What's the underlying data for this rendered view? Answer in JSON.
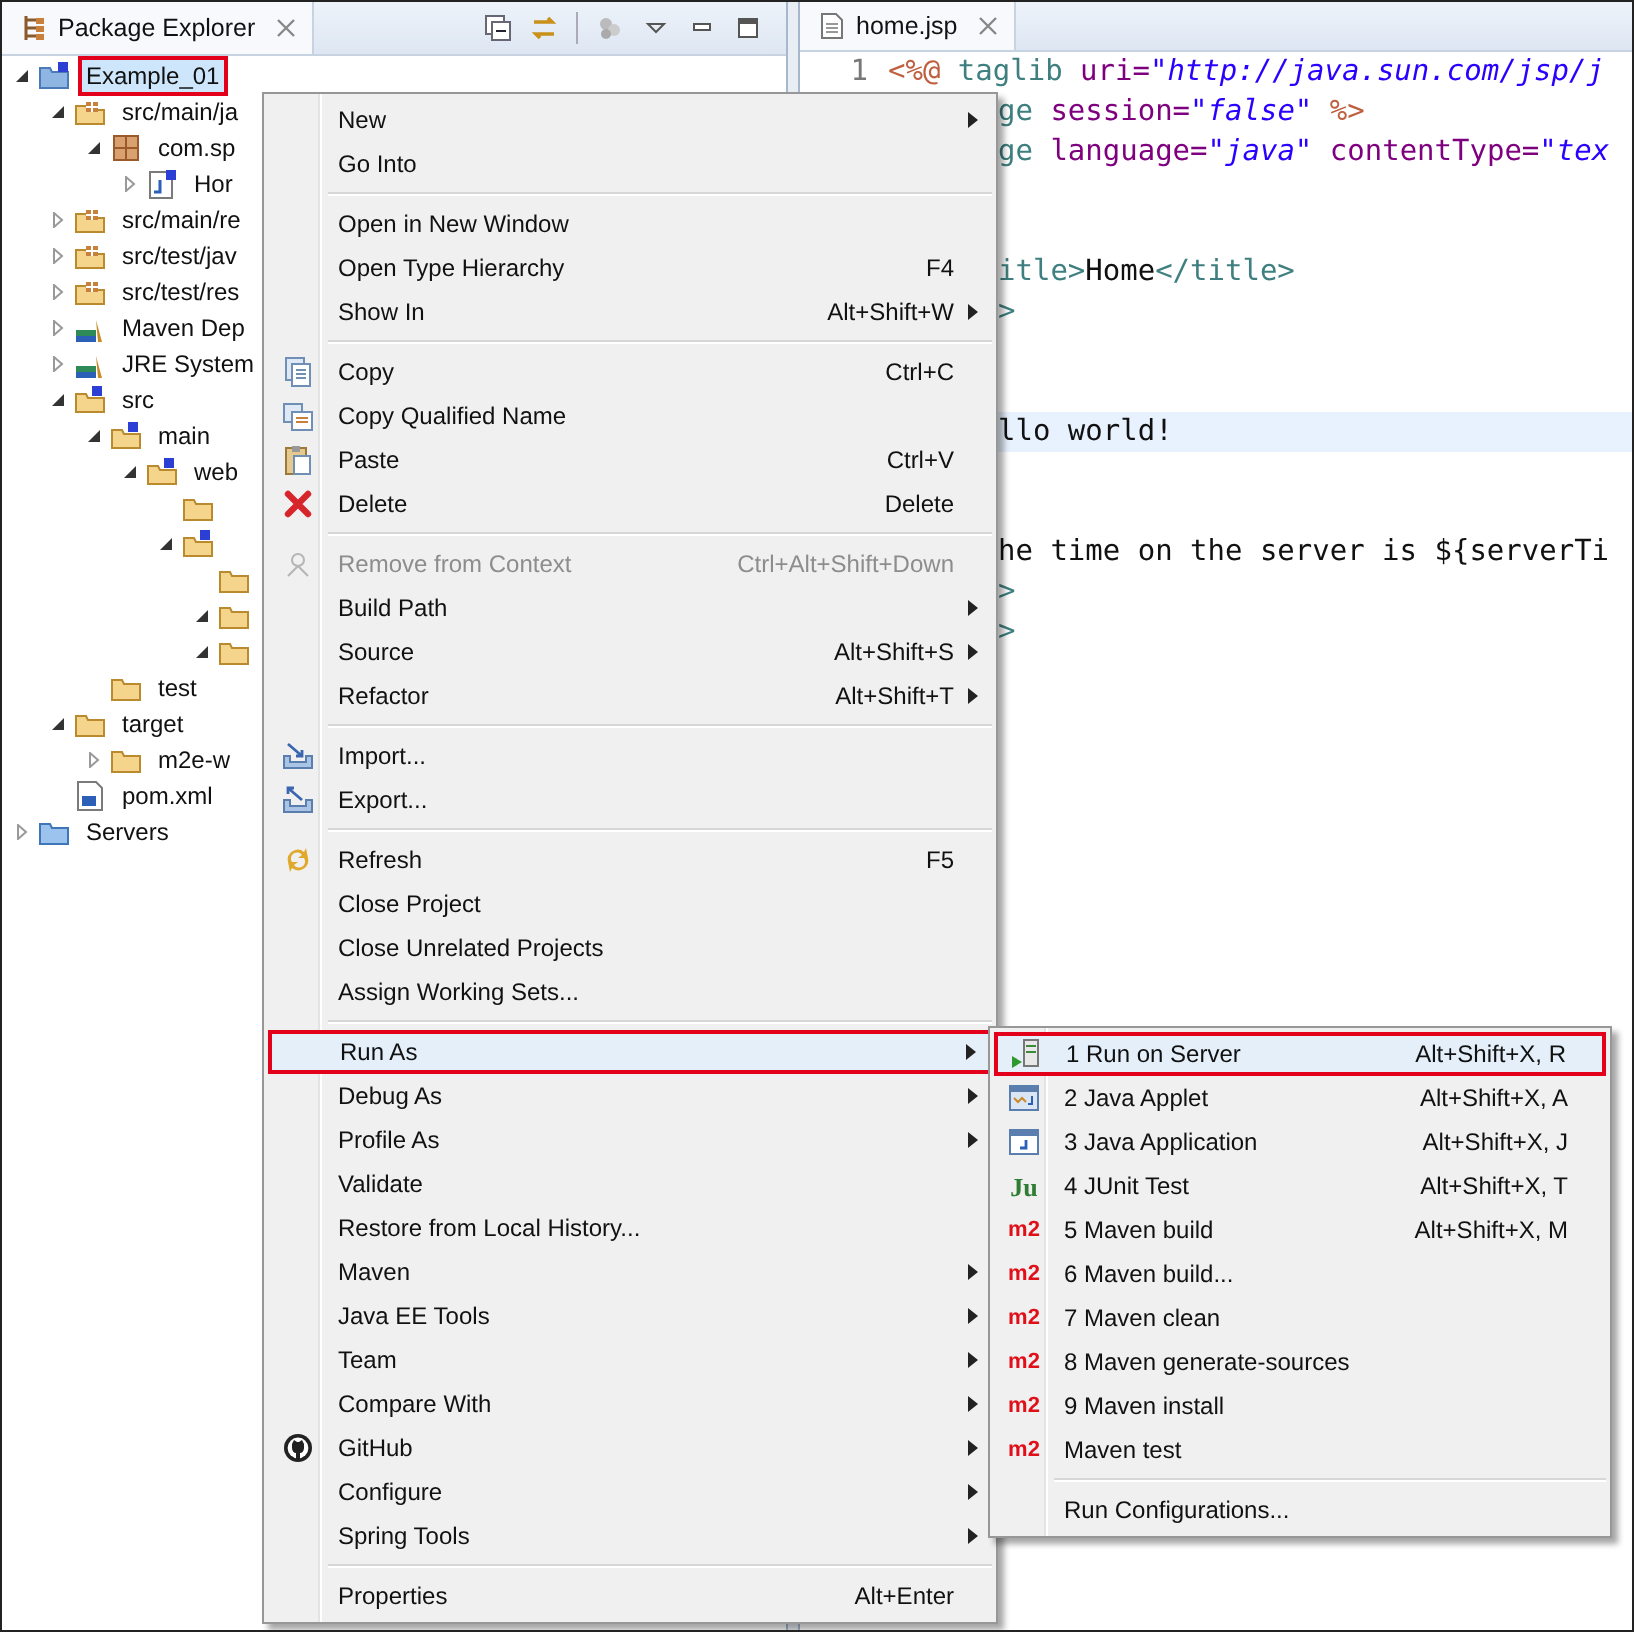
{
  "explorer": {
    "title": "Package Explorer",
    "tree": [
      {
        "kind": "project",
        "label": "Example_01",
        "expanded": true,
        "selected": true,
        "annotated": true,
        "children": [
          {
            "kind": "source-folder",
            "label": "src/main/ja",
            "expanded": true,
            "selected": false,
            "children": [
              {
                "kind": "package",
                "label": "com.sp",
                "expanded": true,
                "selected": false,
                "children": [
                  {
                    "kind": "java-file",
                    "label": "Hor",
                    "expanded": false,
                    "selected": false
                  }
                ]
              }
            ]
          },
          {
            "kind": "source-folder",
            "label": "src/main/re",
            "expanded": false,
            "selected": false
          },
          {
            "kind": "source-folder",
            "label": "src/test/jav",
            "expanded": false,
            "selected": false
          },
          {
            "kind": "source-folder",
            "label": "src/test/res",
            "expanded": false,
            "selected": false
          },
          {
            "kind": "library",
            "label": "Maven Dep",
            "expanded": false,
            "selected": false
          },
          {
            "kind": "library",
            "label": "JRE System",
            "expanded": false,
            "selected": false
          },
          {
            "kind": "web-folder",
            "label": "src",
            "expanded": true,
            "selected": false,
            "children": [
              {
                "kind": "web-folder",
                "label": "main",
                "expanded": true,
                "selected": false,
                "children": [
                  {
                    "kind": "web-folder",
                    "label": "web",
                    "expanded": true,
                    "selected": false,
                    "children": [
                      {
                        "kind": "folder"
                      },
                      {
                        "kind": "web-folder",
                        "expanded": true,
                        "children": [
                          {
                            "kind": "folder"
                          },
                          {
                            "kind": "folder",
                            "expanded": true
                          },
                          {
                            "kind": "folder",
                            "expanded": true
                          }
                        ]
                      }
                    ]
                  }
                ]
              },
              {
                "kind": "folder",
                "label": "test",
                "selected": false
              }
            ]
          },
          {
            "kind": "folder",
            "label": "target",
            "expanded": true,
            "selected": false,
            "children": [
              {
                "kind": "folder",
                "label": "m2e-w",
                "expanded": false,
                "selected": false
              }
            ]
          },
          {
            "kind": "pom",
            "label": "pom.xml",
            "selected": false
          }
        ]
      },
      {
        "kind": "servers",
        "label": "Servers",
        "expanded": false,
        "selected": false
      }
    ]
  },
  "editor": {
    "tab": "home.jsp",
    "lines": [
      {
        "number": "1",
        "current": false,
        "segments": [
          {
            "kind": "directive",
            "text": "<%@"
          },
          {
            "kind": "tag",
            "text": " taglib"
          },
          {
            "kind": "attr",
            "text": " uri="
          },
          {
            "kind": "string",
            "text": "\"http://java.sun.com/jsp/j"
          }
        ]
      },
      {
        "current": false,
        "segments": [
          {
            "kind": "tag",
            "text": "ge"
          },
          {
            "kind": "attr",
            "text": " session="
          },
          {
            "kind": "string",
            "text": "\"false\""
          },
          {
            "kind": "directive",
            "text": " %>"
          }
        ]
      },
      {
        "current": false,
        "segments": [
          {
            "kind": "tag",
            "text": "ge"
          },
          {
            "kind": "attr",
            "text": " language="
          },
          {
            "kind": "string",
            "text": "\"java\""
          },
          {
            "kind": "attr",
            "text": " contentType="
          },
          {
            "kind": "string",
            "text": "\"tex"
          }
        ]
      },
      {
        "current": false
      },
      {
        "current": false
      },
      {
        "current": false,
        "segments": [
          {
            "kind": "tag",
            "text": "itle>"
          },
          {
            "kind": "text",
            "text": "Home"
          },
          {
            "kind": "tag",
            "text": "</title>"
          }
        ]
      },
      {
        "current": false,
        "segments": [
          {
            "kind": "tag",
            "text": ">"
          }
        ]
      },
      {
        "current": false
      },
      {
        "current": false
      },
      {
        "current": true,
        "segments": [
          {
            "kind": "text",
            "text": "llo world!"
          }
        ]
      },
      {
        "current": false
      },
      {
        "current": false
      },
      {
        "current": false,
        "segments": [
          {
            "kind": "text",
            "text": "he time on the server is ${serverTi"
          }
        ]
      },
      {
        "current": false,
        "segments": [
          {
            "kind": "tag",
            "text": ">"
          }
        ]
      },
      {
        "current": false,
        "segments": [
          {
            "kind": "tag",
            "text": ">"
          }
        ]
      }
    ]
  },
  "menu": {
    "items": [
      {
        "kind": "item",
        "label": "New",
        "submenu": true,
        "disabled": false,
        "selected": false
      },
      {
        "kind": "item",
        "label": "Go Into",
        "submenu": false,
        "disabled": false,
        "selected": false
      },
      {
        "kind": "separator"
      },
      {
        "kind": "item",
        "label": "Open in New Window",
        "submenu": false,
        "disabled": false,
        "selected": false
      },
      {
        "kind": "item",
        "label": "Open Type Hierarchy",
        "shortcut": "F4",
        "submenu": false,
        "disabled": false,
        "selected": false
      },
      {
        "kind": "item",
        "label": "Show In",
        "shortcut": "Alt+Shift+W",
        "submenu": true,
        "disabled": false,
        "selected": false
      },
      {
        "kind": "separator"
      },
      {
        "kind": "item",
        "label": "Copy",
        "shortcut": "Ctrl+C",
        "submenu": false,
        "disabled": false,
        "selected": false
      },
      {
        "kind": "item",
        "label": "Copy Qualified Name",
        "submenu": false,
        "disabled": false,
        "selected": false
      },
      {
        "kind": "item",
        "label": "Paste",
        "shortcut": "Ctrl+V",
        "submenu": false,
        "disabled": false,
        "selected": false
      },
      {
        "kind": "item",
        "label": "Delete",
        "shortcut": "Delete",
        "submenu": false,
        "disabled": false,
        "selected": false
      },
      {
        "kind": "separator"
      },
      {
        "kind": "item",
        "label": "Remove from Context",
        "shortcut": "Ctrl+Alt+Shift+Down",
        "submenu": false,
        "disabled": true,
        "selected": false
      },
      {
        "kind": "item",
        "label": "Build Path",
        "submenu": true,
        "disabled": false,
        "selected": false
      },
      {
        "kind": "item",
        "label": "Source",
        "shortcut": "Alt+Shift+S",
        "submenu": true,
        "disabled": false,
        "selected": false
      },
      {
        "kind": "item",
        "label": "Refactor",
        "shortcut": "Alt+Shift+T",
        "submenu": true,
        "disabled": false,
        "selected": false
      },
      {
        "kind": "separator"
      },
      {
        "kind": "item",
        "label": "Import...",
        "submenu": false,
        "disabled": false,
        "selected": false
      },
      {
        "kind": "item",
        "label": "Export...",
        "submenu": false,
        "disabled": false,
        "selected": false
      },
      {
        "kind": "separator"
      },
      {
        "kind": "item",
        "label": "Refresh",
        "shortcut": "F5",
        "submenu": false,
        "disabled": false,
        "selected": false
      },
      {
        "kind": "item",
        "label": "Close Project",
        "submenu": false,
        "disabled": false,
        "selected": false
      },
      {
        "kind": "item",
        "label": "Close Unrelated Projects",
        "submenu": false,
        "disabled": false,
        "selected": false
      },
      {
        "kind": "item",
        "label": "Assign Working Sets...",
        "submenu": false,
        "disabled": false,
        "selected": false
      },
      {
        "kind": "separator"
      },
      {
        "kind": "item",
        "label": "Run As",
        "submenu": true,
        "disabled": false,
        "selected": true,
        "annotated": true
      },
      {
        "kind": "item",
        "label": "Debug As",
        "submenu": true,
        "disabled": false,
        "selected": false
      },
      {
        "kind": "item",
        "label": "Profile As",
        "submenu": true,
        "disabled": false,
        "selected": false
      },
      {
        "kind": "item",
        "label": "Validate",
        "submenu": false,
        "disabled": false,
        "selected": false
      },
      {
        "kind": "item",
        "label": "Restore from Local History...",
        "submenu": false,
        "disabled": false,
        "selected": false
      },
      {
        "kind": "item",
        "label": "Maven",
        "submenu": true,
        "disabled": false,
        "selected": false
      },
      {
        "kind": "item",
        "label": "Java EE Tools",
        "submenu": true,
        "disabled": false,
        "selected": false
      },
      {
        "kind": "item",
        "label": "Team",
        "submenu": true,
        "disabled": false,
        "selected": false
      },
      {
        "kind": "item",
        "label": "Compare With",
        "submenu": true,
        "disabled": false,
        "selected": false
      },
      {
        "kind": "item",
        "label": "GitHub",
        "submenu": true,
        "disabled": false,
        "selected": false
      },
      {
        "kind": "item",
        "label": "Configure",
        "submenu": true,
        "disabled": false,
        "selected": false
      },
      {
        "kind": "item",
        "label": "Spring Tools",
        "submenu": true,
        "disabled": false,
        "selected": false
      },
      {
        "kind": "separator"
      },
      {
        "kind": "item",
        "label": "Properties",
        "shortcut": "Alt+Enter",
        "submenu": false,
        "disabled": false,
        "selected": false
      }
    ]
  },
  "submenu": {
    "items": [
      {
        "kind": "item",
        "label": "1 Run on Server",
        "shortcut": "Alt+Shift+X, R",
        "selected": true,
        "annotated": true
      },
      {
        "kind": "item",
        "label": "2 Java Applet",
        "shortcut": "Alt+Shift+X, A",
        "selected": false
      },
      {
        "kind": "item",
        "label": "3 Java Application",
        "shortcut": "Alt+Shift+X, J",
        "selected": false
      },
      {
        "kind": "item",
        "label": "4 JUnit Test",
        "shortcut": "Alt+Shift+X, T",
        "badge": "Ju",
        "selected": false
      },
      {
        "kind": "item",
        "label": "5 Maven build",
        "shortcut": "Alt+Shift+X, M",
        "badge": "m2",
        "selected": false
      },
      {
        "kind": "item",
        "label": "6 Maven build...",
        "badge": "m2",
        "selected": false
      },
      {
        "kind": "item",
        "label": "7 Maven clean",
        "badge": "m2",
        "selected": false
      },
      {
        "kind": "item",
        "label": "8 Maven generate-sources",
        "badge": "m2",
        "selected": false
      },
      {
        "kind": "item",
        "label": "9 Maven install",
        "badge": "m2",
        "selected": false
      },
      {
        "kind": "item",
        "label": "Maven test",
        "badge": "m2",
        "selected": false
      },
      {
        "kind": "separator"
      },
      {
        "kind": "item",
        "label": "Run Configurations...",
        "selected": false
      }
    ]
  }
}
